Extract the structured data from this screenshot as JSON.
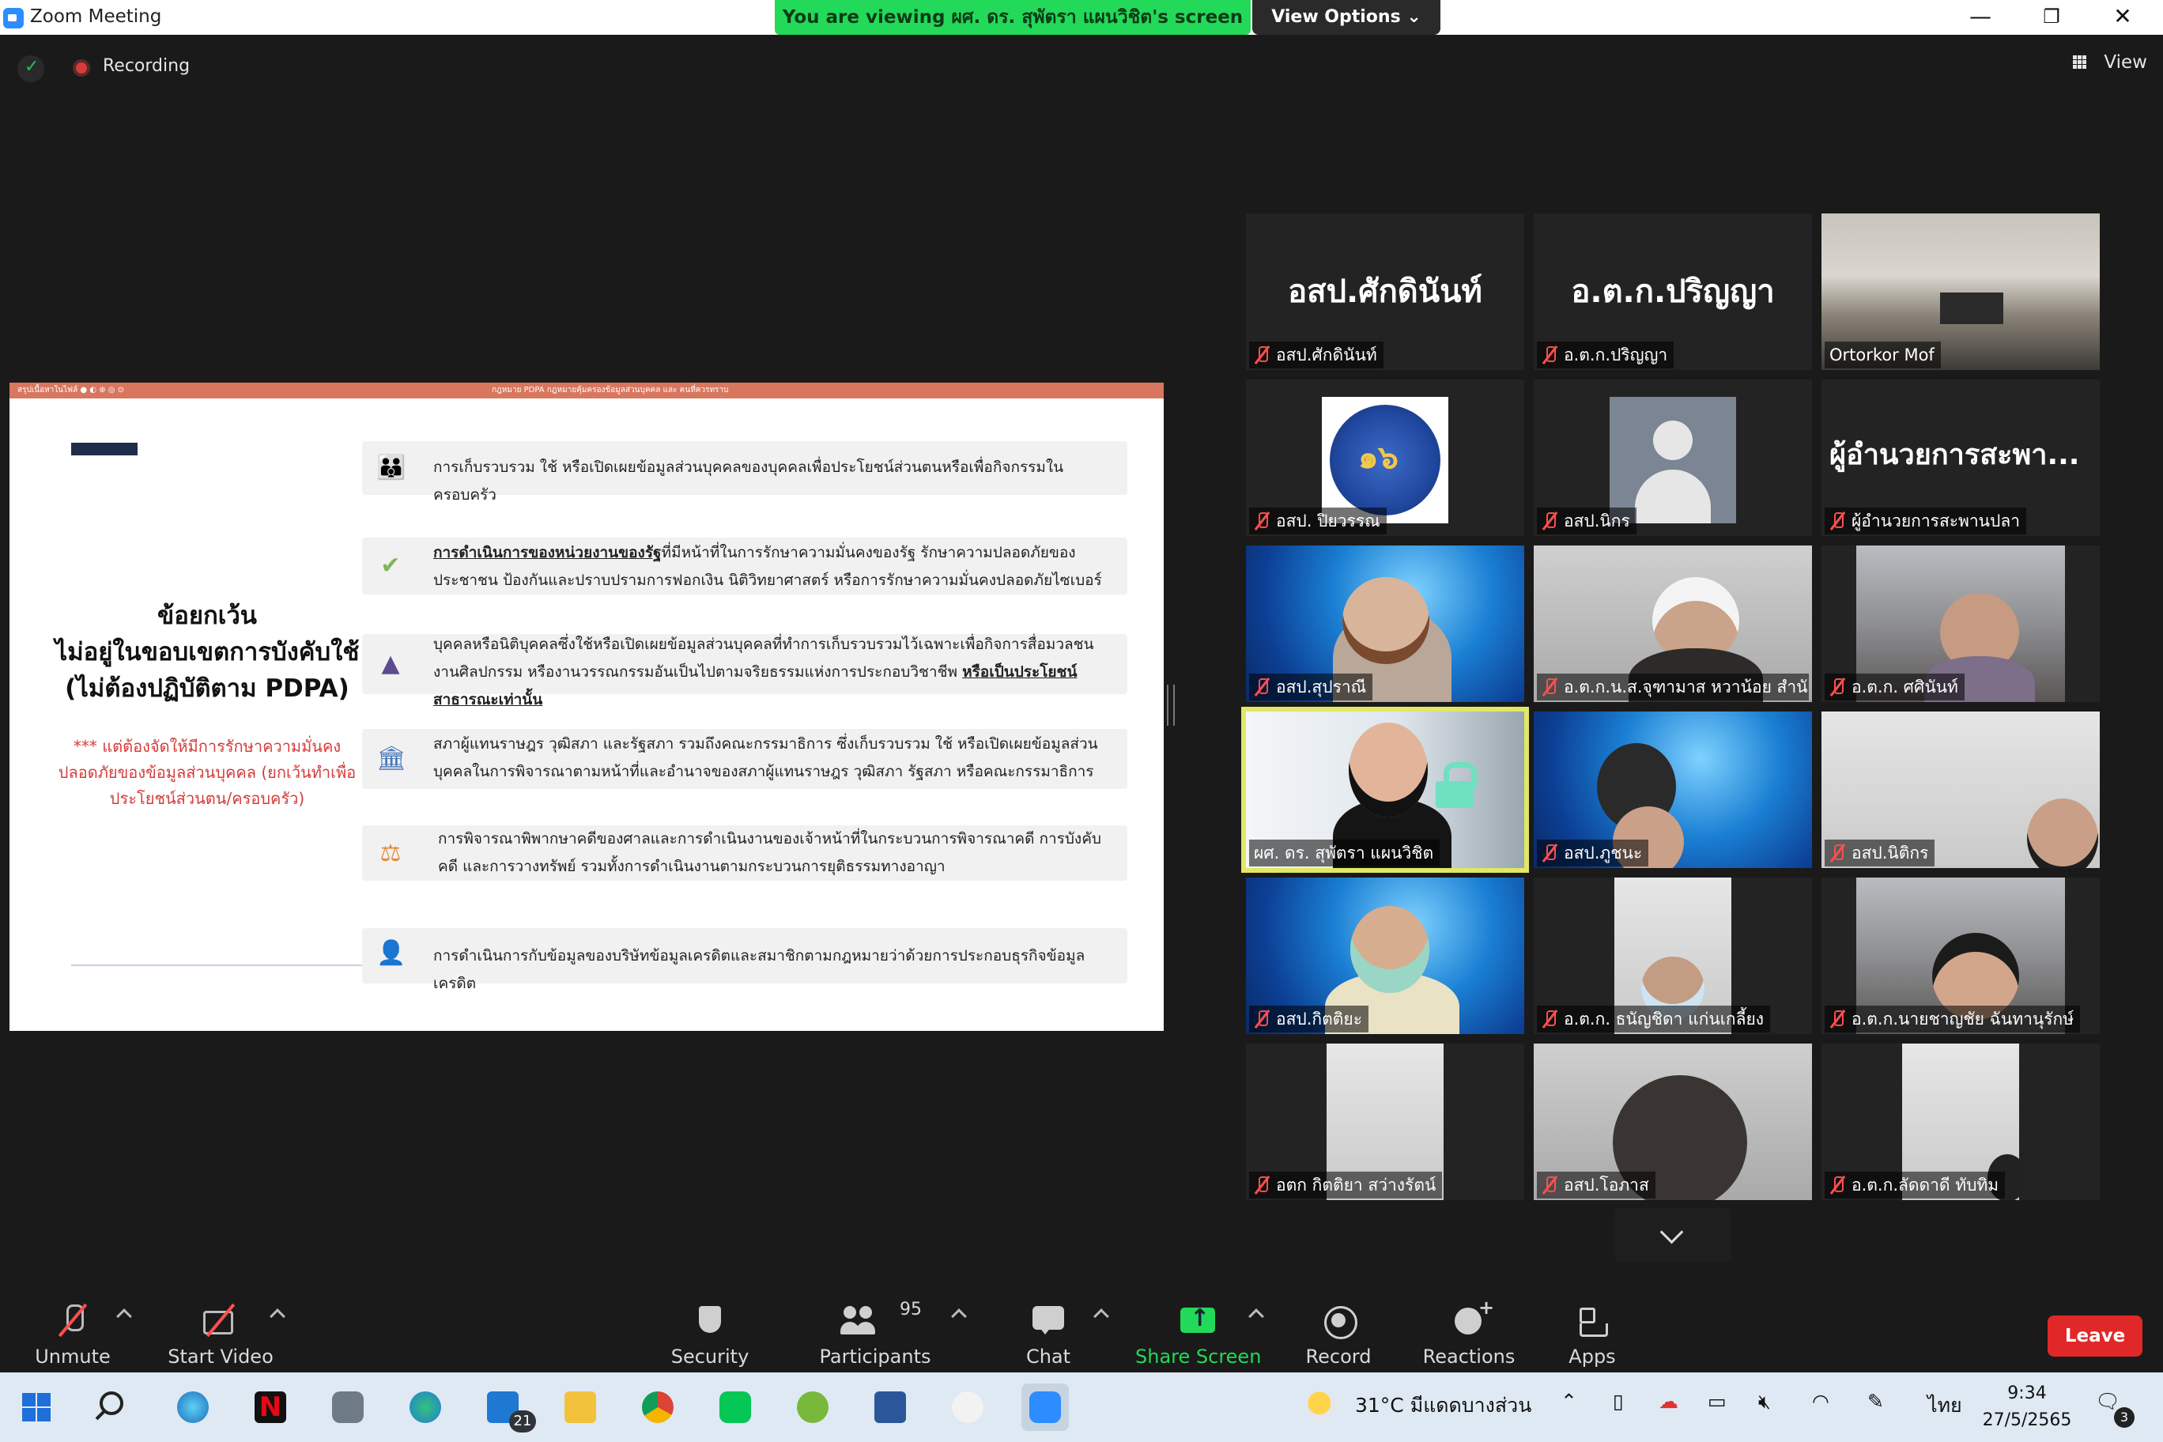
{
  "window": {
    "title": "Zoom Meeting",
    "viewing_banner": "You are viewing ผศ. ดร. สุพัตรา แผนวิชิต's screen",
    "view_options": "View Options ⌄",
    "minimize": "—",
    "restore": "❐",
    "close": "✕"
  },
  "topbar": {
    "recording_label": "Recording",
    "view_label": "View"
  },
  "slide": {
    "topbar_left": "สรุปเนื้อหาในไฟล์ ● ◐ ⊕ ◎ ⊙",
    "topbar_mid": "กฎหมาย PDPA กฎหมายคุ้มครองข้อมูลส่วนบุคคล และ คนที่ควรทราบ",
    "heading_line1": "ข้อยกเว้น",
    "heading_line2": "ไม่อยู่ในขอบเขตการบังคับใช้",
    "heading_line3": "(ไม่ต้องปฏิบัติตาม PDPA)",
    "note": "*** แต่ต้องจัดให้มีการรักษาความมั่นคงปลอดภัยของข้อมูลส่วนบุคคล (ยกเว้นทำเพื่อประโยชน์ส่วนตน/ครอบครัว)",
    "rows": [
      {
        "icon": "👪",
        "text": "การเก็บรวบรวม ใช้ หรือเปิดเผยข้อมูลส่วนบุคคลของบุคคลเพื่อประโยชน์ส่วนตนหรือเพื่อกิจกรรมในครอบครัว"
      },
      {
        "icon": "✔",
        "text_bold": "การดำเนินการของหน่วยงานของรัฐ",
        "text": "ที่มีหน้าที่ในการรักษาความมั่นคงของรัฐ รักษาความปลอดภัยของประชาชน ป้องกันและปราบปรามการฟอกเงิน นิติวิทยาศาสตร์ หรือการรักษาความมั่นคงปลอดภัยไซเบอร์"
      },
      {
        "icon": "▲",
        "text": "บุคคลหรือนิติบุคคลซึ่งใช้หรือเปิดเผยข้อมูลส่วนบุคคลที่ทำการเก็บรวบรวมไว้เฉพาะเพื่อกิจการสื่อมวลชน งานศิลปกรรม หรืองานวรรณกรรมอันเป็นไปตามจริยธรรมแห่งการประกอบวิชาชีพ",
        "text_bold": "หรือเป็นประโยชน์สาธารณะเท่านั้น"
      },
      {
        "icon": "🏛",
        "text": "สภาผู้แทนราษฎร วุฒิสภา และรัฐสภา รวมถึงคณะกรรมาธิการ ซึ่งเก็บรวบรวม ใช้ หรือเปิดเผยข้อมูลส่วนบุคคลในการพิจารณาตามหน้าที่และอำนาจของสภาผู้แทนราษฎร วุฒิสภา รัฐสภา หรือคณะกรรมาธิการ"
      },
      {
        "icon": "⚖",
        "text": "การพิจารณาพิพากษาคดีของศาลและการดำเนินงานของเจ้าหน้าที่ในกระบวนการพิจารณาคดี การบังคับคดี และการวางทรัพย์ รวมทั้งการดำเนินงานตามกระบวนการยุติธรรมทางอาญา"
      },
      {
        "icon": "👤",
        "text": "การดำเนินการกับข้อมูลของบริษัทข้อมูลเครดิตและสมาชิกตามกฎหมายว่าด้วยการประกอบธุรกิจข้อมูลเครดิต"
      }
    ]
  },
  "participants": [
    {
      "name": "อสป.ศักดินันท์",
      "big_name": "อสป.ศักดินันท์",
      "muted": true
    },
    {
      "name": "อ.ต.ก.ปริญญา",
      "big_name": "อ.ต.ก.ปริญญา",
      "muted": true
    },
    {
      "name": "Ortorkor Mof",
      "muted": false
    },
    {
      "name": "อสป. ปิยวรรณ",
      "muted": true
    },
    {
      "name": "อสป.นิกร",
      "muted": true
    },
    {
      "name": "ผู้อำนวยการสะพานปลา",
      "big_name": "ผู้อำนวยการสะพา...",
      "muted": true
    },
    {
      "name": "อสป.สุปราณี",
      "muted": true
    },
    {
      "name": "อ.ต.ก.น.ส.จุฑามาส หวาน้อย สำนั...",
      "muted": true
    },
    {
      "name": "อ.ต.ก. ศศินันท์",
      "muted": true
    },
    {
      "name": "ผศ. ดร. สุพัตรา แผนวิชิต",
      "muted": false
    },
    {
      "name": "อสป.ภูชนะ",
      "muted": true
    },
    {
      "name": "อสป.นิติกร",
      "muted": true
    },
    {
      "name": "อสป.กิตติยะ",
      "muted": true
    },
    {
      "name": "อ.ต.ก. ธนัญชิดา แก่นเกลี้ยง",
      "muted": true
    },
    {
      "name": "อ.ต.ก.นายชาญชัย ฉันทานุรักษ์",
      "muted": true
    },
    {
      "name": "อตก กิตติยา สว่างรัตน์",
      "muted": true
    },
    {
      "name": "อสป.โอภาส",
      "muted": true
    },
    {
      "name": "อ.ต.ก.ลัดดาดี ทับทิม",
      "muted": true
    }
  ],
  "toolbar": {
    "unmute": "Unmute",
    "start_video": "Start Video",
    "security": "Security",
    "participants": "Participants",
    "participants_count": "95",
    "chat": "Chat",
    "share_screen": "Share Screen",
    "record": "Record",
    "reactions": "Reactions",
    "apps": "Apps",
    "leave": "Leave"
  },
  "taskbar": {
    "mail_badge": "21",
    "weather": "31°C มีแดดบางส่วน",
    "language": "ไทย",
    "time": "9:34",
    "date": "27/5/2565",
    "notification_count": "3"
  },
  "colors": {
    "share_green": "#23d959",
    "leave_red": "#e02828",
    "active_speaker": "#e0e866",
    "mute_red": "#ff4e4e"
  }
}
